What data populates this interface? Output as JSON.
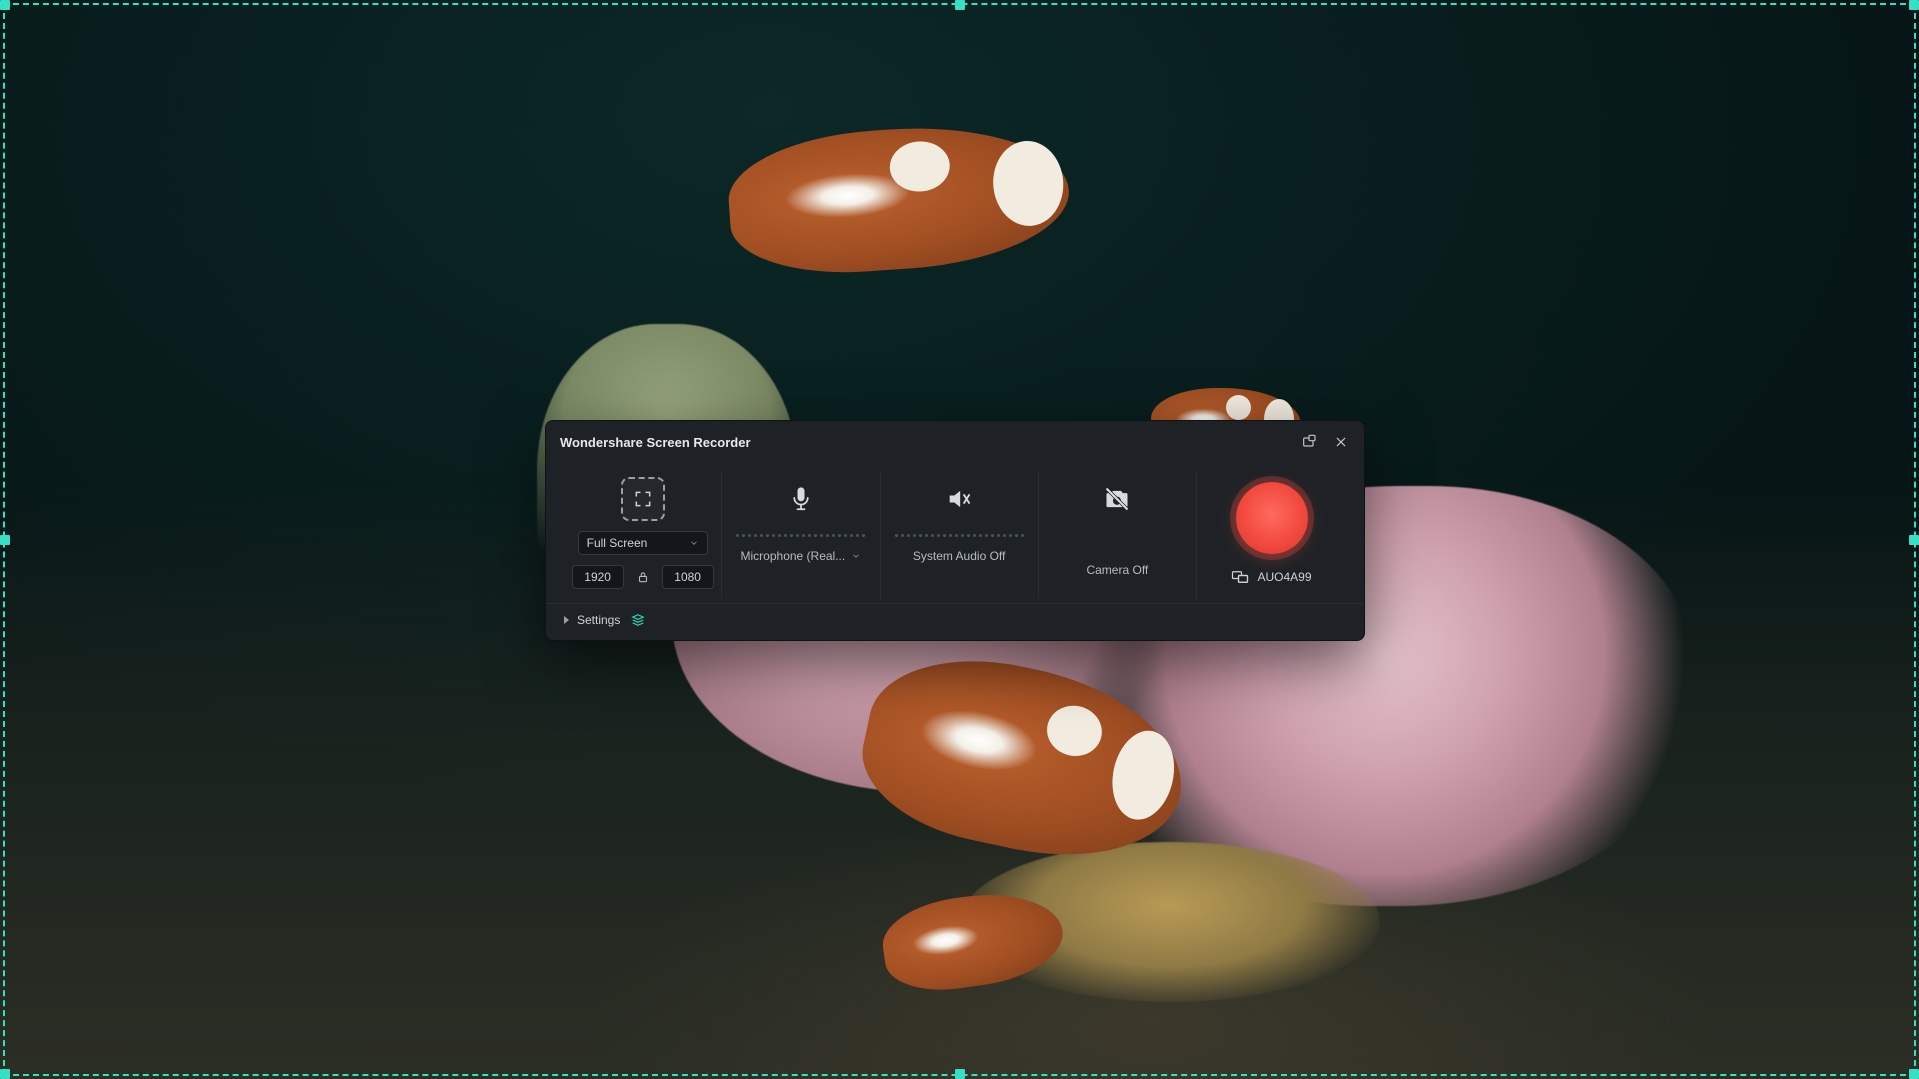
{
  "panel": {
    "title": "Wondershare Screen Recorder",
    "capture": {
      "mode_label": "Full Screen",
      "width": "1920",
      "height": "1080"
    },
    "microphone": {
      "device_label": "Microphone (Real..."
    },
    "system_audio": {
      "status_label": "System Audio Off"
    },
    "camera": {
      "status_label": "Camera Off"
    },
    "display": {
      "name": "AUO4A99"
    },
    "footer": {
      "settings_label": "Settings"
    }
  },
  "colors": {
    "accent": "#35e0c4",
    "record": "#f24a3f",
    "panel_bg": "#1e2226"
  }
}
